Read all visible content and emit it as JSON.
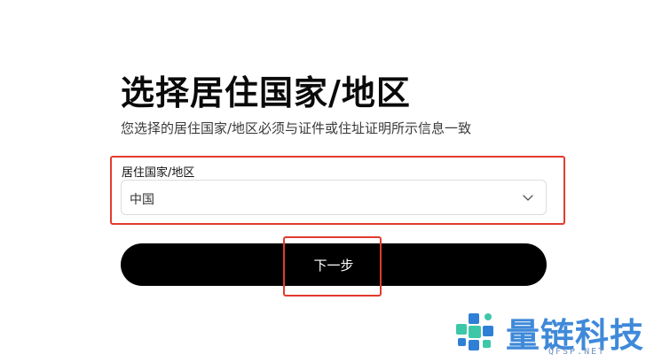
{
  "page": {
    "title": "选择居住国家/地区",
    "subtitle": "您选择的居住国家/地区必须与证件或住址证明所示信息一致"
  },
  "country_field": {
    "label": "居住国家/地区",
    "selected_value": "中国",
    "icon": "chevron-down-icon"
  },
  "actions": {
    "next_label": "下一步"
  },
  "watermark": {
    "brand_text": "量链科技",
    "domain_text": "QFSP.NET",
    "icon": "puzzle-logo-icon"
  },
  "colors": {
    "highlight": "#e23b2e",
    "button_bg": "#000000",
    "button_text": "#ffffff",
    "watermark_blue": "#2f7fd6",
    "watermark_green": "#3cc8a8"
  }
}
